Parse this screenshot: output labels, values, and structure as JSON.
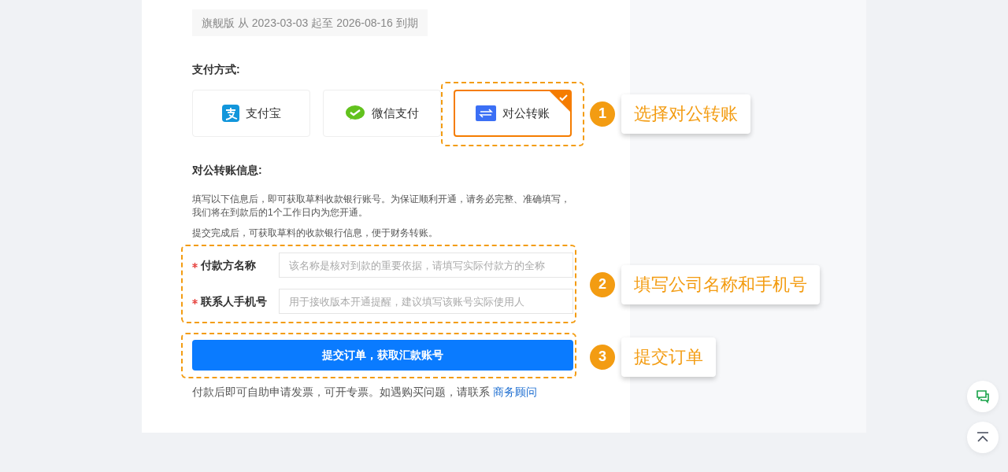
{
  "version_notice": "旗舰版 从 2023-03-03 起至 2026-08-16 到期",
  "payment": {
    "label": "支付方式:",
    "methods": [
      {
        "kind": "alipay",
        "label": "支付宝",
        "selected": false
      },
      {
        "kind": "wechat",
        "label": "微信支付",
        "selected": false
      },
      {
        "kind": "transfer",
        "label": "对公转账",
        "selected": true
      }
    ]
  },
  "transfer_info": {
    "heading": "对公转账信息:",
    "paragraphs": [
      "填写以下信息后，即可获取草料收款银行账号。为保证顺利开通，请务必完整、准确填写，我们将在到款后的1个工作日内为您开通。",
      "提交完成后，可获取草料的收款银行信息，便于财务转账。"
    ],
    "fields": [
      {
        "label": "付款方名称",
        "required": true,
        "placeholder": "该名称是核对到款的重要依据，请填写实际付款方的全称"
      },
      {
        "label": "联系人手机号",
        "required": true,
        "placeholder": "用于接收版本开通提醒，建议填写该账号实际使用人"
      }
    ]
  },
  "submit_button": "提交订单，获取汇款账号",
  "footer": {
    "text": "付款后即可自助申请发票，可开专票。如遇购买问题，请联系",
    "link": "商务顾问"
  },
  "annotations": [
    {
      "number": "1",
      "text": "选择对公转账"
    },
    {
      "number": "2",
      "text": "填写公司名称和手机号"
    },
    {
      "number": "3",
      "text": "提交订单"
    }
  ]
}
